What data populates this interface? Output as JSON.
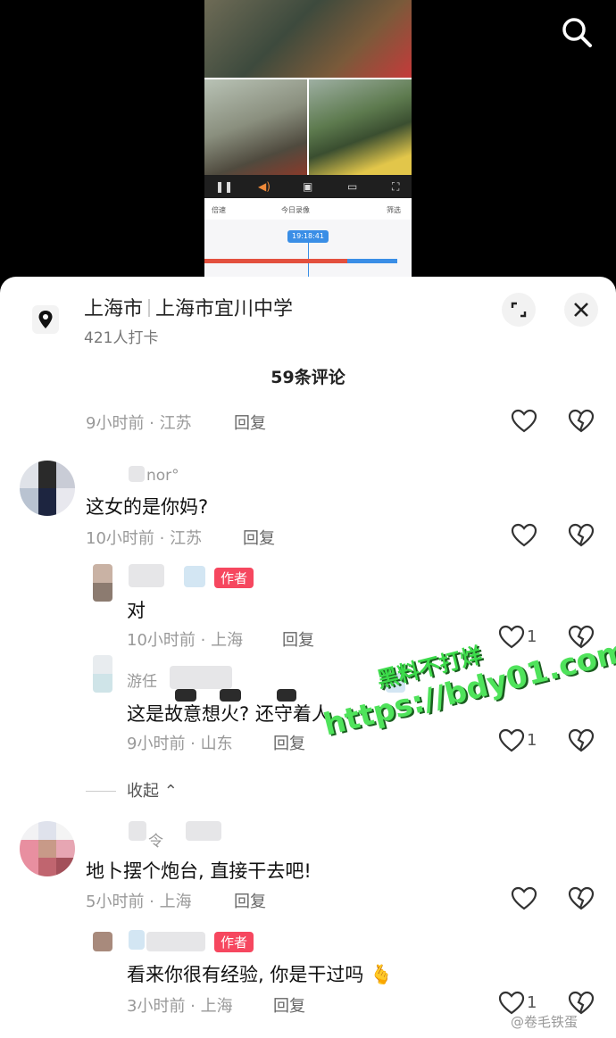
{
  "location": {
    "city": "上海市",
    "place": "上海市宜川中学",
    "checkins": "421人打卡"
  },
  "comments_count": "59条评论",
  "player": {
    "replay_label": "今日录像",
    "speed_label": "倍速",
    "filter_label": "筛选",
    "time": "19:18:41"
  },
  "comments": [
    {
      "time": "9小时前 · 江苏",
      "reply": "回复"
    },
    {
      "username": "nor°",
      "text": "这女的是你妈?",
      "time": "10小时前 · 江苏",
      "reply": "回复"
    },
    {
      "badge": "作者",
      "text": "对",
      "time": "10小时前 · 上海",
      "reply": "回复",
      "likes": "1"
    },
    {
      "username": "游任",
      "text": "这是故意想火? 还守着人",
      "time": "9小时前 · 山东",
      "reply": "回复",
      "likes": "1"
    },
    {
      "username": "令",
      "text": "地卜摆个炮台, 直接干去吧!",
      "time": "5小时前 · 上海",
      "reply": "回复"
    },
    {
      "badge": "作者",
      "text": "看来你很有经验, 你是干过吗",
      "emoji": "🫰",
      "time": "3小时前 · 上海",
      "reply": "回复",
      "likes": "1"
    }
  ],
  "collapse_label": "收起",
  "watermark": {
    "line1": "黑料不打烊",
    "line2": "https://bdy01.com"
  },
  "credit": "@卷毛铁蛋",
  "colors": {
    "author_badge": "#f6475f",
    "timeline_red": "#e3503e",
    "timeline_blue": "#3a8ee6"
  }
}
